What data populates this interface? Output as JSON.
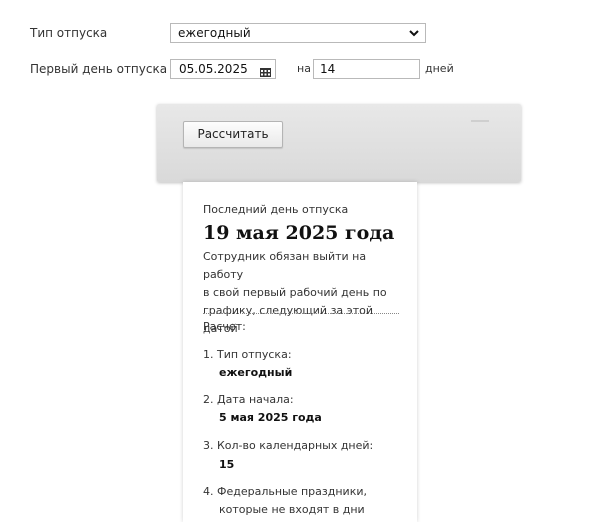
{
  "form": {
    "vacation_type_label": "Тип отпуска",
    "vacation_type_value": "ежегодный",
    "first_day_label": "Первый день отпуска",
    "first_day_value": "05.05.2025",
    "for_label": "на",
    "days_value": "14",
    "days_unit": "дней",
    "calculate_label": "Рассчитать"
  },
  "result": {
    "last_day_label": "Последний день отпуска",
    "last_day_value": "19 мая 2025 года",
    "note_line1": "Сотрудник обязан выйти на работу",
    "note_line2": "в свой первый рабочий день по",
    "note_line3": "графику, следующий за этой датой",
    "calc_label": "Расчет:",
    "items": [
      {
        "label": "1. Тип отпуска:",
        "value": "ежегодный"
      },
      {
        "label": "2. Дата начала:",
        "value": "5 мая 2025 года"
      },
      {
        "label": "3. Кол-во календарных дней:",
        "value": "15"
      },
      {
        "label": "4. Федеральные праздники,",
        "value": "которые не входят в дни"
      }
    ]
  }
}
